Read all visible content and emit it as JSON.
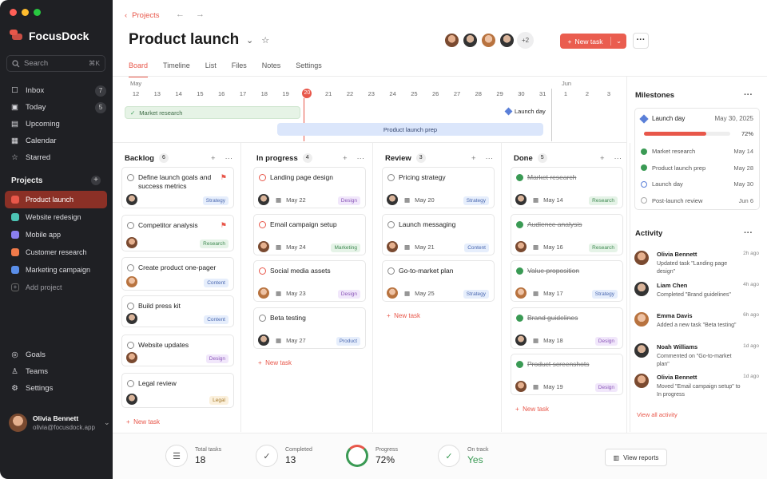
{
  "app": {
    "name": "FocusDock"
  },
  "colors": {
    "accent": "#e8574a",
    "sidebar": "#1f2024",
    "done_green": "#3a9a54"
  },
  "search": {
    "placeholder": "Search",
    "shortcut": "⌘K"
  },
  "nav": [
    {
      "label": "Inbox",
      "icon": "inbox-icon",
      "badge": "7"
    },
    {
      "label": "Today",
      "icon": "calendar-today-icon",
      "badge": "5"
    },
    {
      "label": "Upcoming",
      "icon": "upcoming-icon",
      "badge": ""
    },
    {
      "label": "Calendar",
      "icon": "calendar-icon",
      "badge": ""
    },
    {
      "label": "Starred",
      "icon": "star-icon",
      "badge": ""
    }
  ],
  "projects_title": "Projects",
  "projects": [
    {
      "label": "Product launch",
      "color": "#e8574a"
    },
    {
      "label": "Website redesign",
      "color": "#4cc4b4"
    },
    {
      "label": "Mobile app",
      "color": "#8a7ff0"
    },
    {
      "label": "Customer research",
      "color": "#f07a4a"
    },
    {
      "label": "Marketing campaign",
      "color": "#5a8ee8"
    }
  ],
  "add_project": "Add project",
  "bottom_nav": [
    {
      "label": "Goals",
      "icon": "goals-icon"
    },
    {
      "label": "Teams",
      "icon": "teams-icon"
    },
    {
      "label": "Settings",
      "icon": "settings-icon"
    }
  ],
  "user": {
    "name": "Olivia Bennett",
    "email": "olivia@focusdock.app"
  },
  "breadcrumb": "Projects",
  "page_title": "Product launch",
  "more_members": "+2",
  "new_task_button": "New task",
  "tabs": [
    "Board",
    "Timeline",
    "List",
    "Files",
    "Notes",
    "Settings"
  ],
  "timeline": {
    "month1": "May",
    "month2": "Jun",
    "days": [
      "12",
      "13",
      "14",
      "15",
      "16",
      "17",
      "18",
      "19",
      "20",
      "21",
      "22",
      "23",
      "24",
      "25",
      "26",
      "27",
      "28",
      "29",
      "30",
      "31"
    ],
    "jun_days": [
      "1",
      "2",
      "3"
    ],
    "today": "20",
    "bar1": "Market research",
    "bar2": "Product launch prep",
    "milestone": "Launch day"
  },
  "columns": [
    {
      "title": "Backlog",
      "count": "6",
      "cards": [
        {
          "title": "Define launch goals and success metrics",
          "tag": "Strategy",
          "flag": true
        },
        {
          "title": "Competitor analysis",
          "tag": "Research",
          "flag": true
        },
        {
          "title": "Create product one-pager",
          "tag": "Content"
        },
        {
          "title": "Build press kit",
          "tag": "Content"
        },
        {
          "title": "Website updates",
          "tag": "Design"
        },
        {
          "title": "Legal review",
          "tag": "Legal"
        }
      ]
    },
    {
      "title": "In progress",
      "count": "4",
      "cards": [
        {
          "title": "Landing page design",
          "date": "May 22",
          "tag": "Design"
        },
        {
          "title": "Email campaign setup",
          "date": "May 24",
          "tag": "Marketing"
        },
        {
          "title": "Social media assets",
          "date": "May 23",
          "tag": "Design"
        },
        {
          "title": "Beta testing",
          "date": "May 27",
          "tag": "Product"
        }
      ]
    },
    {
      "title": "Review",
      "count": "3",
      "cards": [
        {
          "title": "Pricing strategy",
          "date": "May 20",
          "tag": "Strategy"
        },
        {
          "title": "Launch messaging",
          "date": "May 21",
          "tag": "Content"
        },
        {
          "title": "Go-to-market plan",
          "date": "May 25",
          "tag": "Strategy"
        }
      ]
    },
    {
      "title": "Done",
      "count": "5",
      "cards": [
        {
          "title": "Market research",
          "date": "May 14",
          "tag": "Research"
        },
        {
          "title": "Audience analysis",
          "date": "May 16",
          "tag": "Research"
        },
        {
          "title": "Value proposition",
          "date": "May 17",
          "tag": "Strategy"
        },
        {
          "title": "Brand guidelines",
          "date": "May 18",
          "tag": "Design"
        },
        {
          "title": "Product screenshots",
          "date": "May 19",
          "tag": "Design"
        }
      ]
    }
  ],
  "new_task_link": "New task",
  "milestones": {
    "title": "Milestones",
    "main": {
      "name": "Launch day",
      "date": "May 30, 2025",
      "progress": 72,
      "progress_label": "72%"
    },
    "items": [
      {
        "name": "Market research",
        "date": "May 14",
        "status": "done"
      },
      {
        "name": "Product launch prep",
        "date": "May 28",
        "status": "done"
      },
      {
        "name": "Launch day",
        "date": "May 30",
        "status": "upcoming"
      },
      {
        "name": "Post-launch review",
        "date": "Jun 6",
        "status": "pending"
      }
    ]
  },
  "activity": {
    "title": "Activity",
    "items": [
      {
        "name": "Olivia Bennett",
        "text": "Updated task \"Landing page design\"",
        "time": "2h ago"
      },
      {
        "name": "Liam Chen",
        "text": "Completed \"Brand guidelines\"",
        "time": "4h ago"
      },
      {
        "name": "Emma Davis",
        "text": "Added a new task \"Beta testing\"",
        "time": "6h ago"
      },
      {
        "name": "Noah Williams",
        "text": "Commented on \"Go-to-market plan\"",
        "time": "1d ago"
      },
      {
        "name": "Olivia Bennett",
        "text": "Moved \"Email campaign setup\" to In progress",
        "time": "1d ago"
      }
    ],
    "view_all": "View all activity"
  },
  "stats": [
    {
      "label": "Total tasks",
      "value": "18",
      "icon": "list-icon"
    },
    {
      "label": "Completed",
      "value": "13",
      "icon": "check-icon"
    },
    {
      "label": "Progress",
      "value": "72%",
      "icon": "progress-ring-icon"
    },
    {
      "label": "On track",
      "value": "Yes",
      "icon": "on-track-icon"
    }
  ],
  "view_reports": "View reports"
}
